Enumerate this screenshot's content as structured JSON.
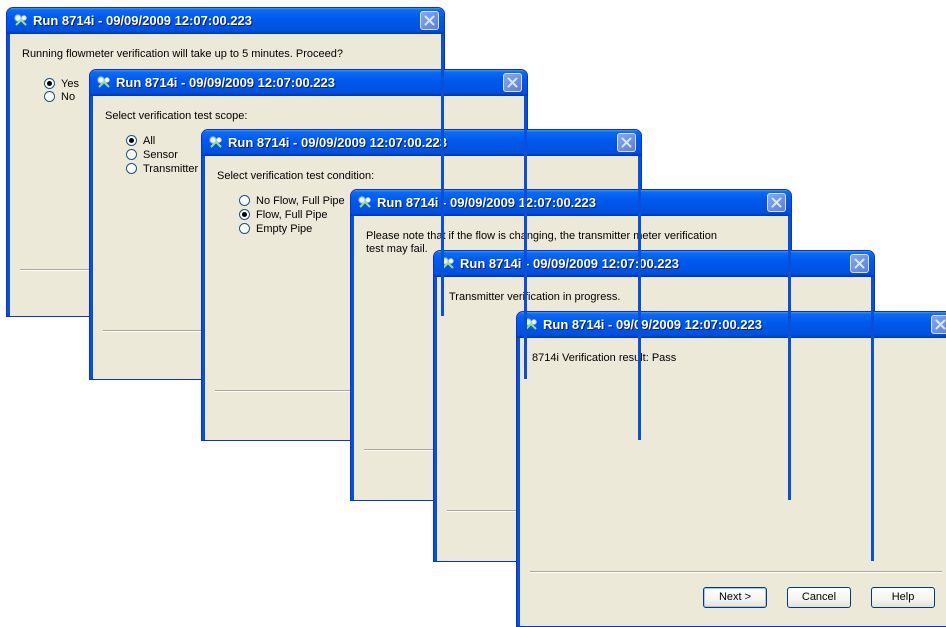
{
  "window_title": "Run 8714i - 09/09/2009 12:07:00.223",
  "icon_name": "flowmeter-app-icon",
  "dialogs": {
    "d1": {
      "message": "Running flowmeter verification will take up to 5 minutes. Proceed?",
      "options": [
        "Yes",
        "No"
      ],
      "selected": "Yes"
    },
    "d2": {
      "message": "Select verification test scope:",
      "options": [
        "All",
        "Sensor",
        "Transmitter"
      ],
      "selected": "All"
    },
    "d3": {
      "message": "Select verification test condition:",
      "options": [
        "No Flow, Full Pipe",
        "Flow, Full Pipe",
        "Empty Pipe"
      ],
      "selected": "Flow, Full Pipe"
    },
    "d4": {
      "message_line1": "Please note that if the flow is changing, the transmitter meter verification",
      "message_line2": "test may fail."
    },
    "d5": {
      "message": "Transmitter verification in progress."
    },
    "d6": {
      "message": "8714i Verification result: Pass",
      "buttons": {
        "next": "Next >",
        "cancel": "Cancel",
        "help": "Help"
      }
    }
  },
  "colors": {
    "titlebar": "#0054e3",
    "dialog_bg": "#ece9d8",
    "frame": "#0831d9"
  }
}
